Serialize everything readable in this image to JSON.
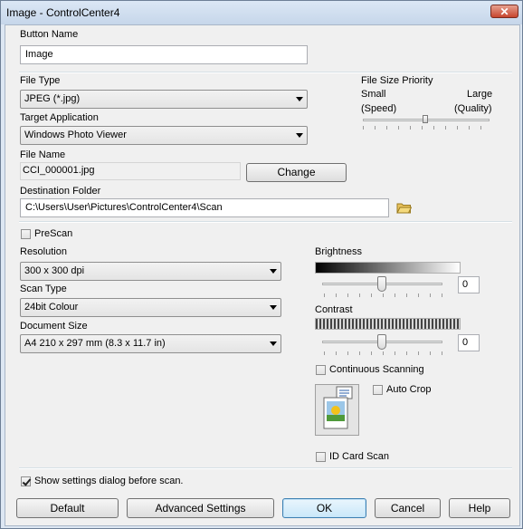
{
  "window": {
    "title": "Image - ControlCenter4",
    "close_label": "✕"
  },
  "button_name": {
    "label": "Button Name",
    "value": "Image"
  },
  "file_type": {
    "label": "File Type",
    "value": "JPEG (*.jpg)"
  },
  "target_application": {
    "label": "Target Application",
    "value": "Windows Photo Viewer"
  },
  "file_name": {
    "label": "File Name",
    "value": "CCI_000001.jpg",
    "change_label": "Change"
  },
  "destination_folder": {
    "label": "Destination Folder",
    "value": "C:\\Users\\User\\Pictures\\ControlCenter4\\Scan"
  },
  "file_size_priority": {
    "label": "File Size Priority",
    "small": "Small",
    "large": "Large",
    "speed": "(Speed)",
    "quality": "(Quality)",
    "level": 0.5
  },
  "prescan": {
    "label": "PreScan",
    "checked": false
  },
  "resolution": {
    "label": "Resolution",
    "value": "300 x 300 dpi"
  },
  "scan_type": {
    "label": "Scan Type",
    "value": "24bit Colour"
  },
  "document_size": {
    "label": "Document Size",
    "value": "A4 210 x 297 mm (8.3 x 11.7 in)"
  },
  "brightness": {
    "label": "Brightness",
    "value": "0"
  },
  "contrast": {
    "label": "Contrast",
    "value": "0"
  },
  "continuous_scanning": {
    "label": "Continuous Scanning",
    "checked": false
  },
  "auto_crop": {
    "label": "Auto Crop",
    "checked": false
  },
  "id_card_scan": {
    "label": "ID Card Scan",
    "checked": false
  },
  "show_settings": {
    "label": "Show settings dialog before scan.",
    "checked": true
  },
  "buttons": {
    "default": "Default",
    "advanced": "Advanced Settings",
    "ok": "OK",
    "cancel": "Cancel",
    "help": "Help"
  }
}
